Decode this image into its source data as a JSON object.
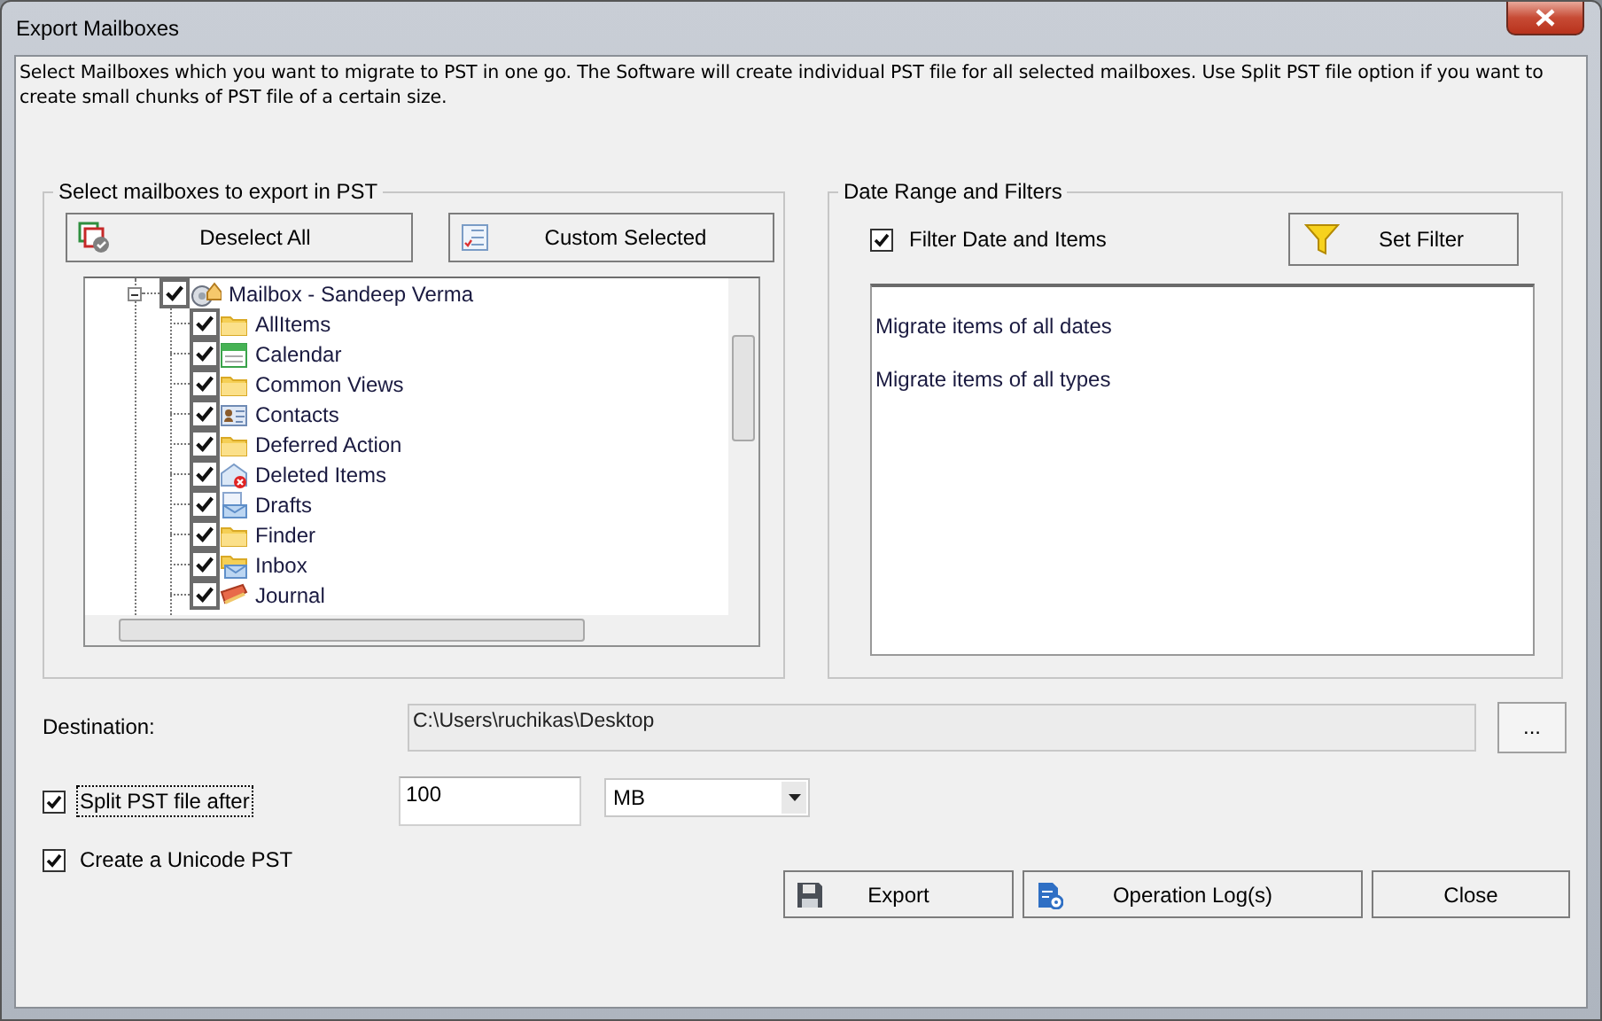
{
  "window": {
    "title": "Export Mailboxes"
  },
  "description": "Select Mailboxes which you want to migrate to PST in one go. The Software will create individual PST file for all selected mailboxes. Use Split PST file option if you want to create small chunks of PST file of a certain size.",
  "mailbox_group": {
    "title": "Select mailboxes to export in PST",
    "buttons": [
      {
        "label": "Deselect All"
      },
      {
        "label": "Custom Selected"
      }
    ],
    "tree": [
      {
        "label": "Mailbox - Sandeep  Verma",
        "kind": "mailbox",
        "checked": true,
        "expanded": true,
        "children": [
          {
            "label": "AllItems",
            "kind": "folder",
            "checked": true
          },
          {
            "label": "Calendar",
            "kind": "calendar",
            "checked": true
          },
          {
            "label": "Common Views",
            "kind": "folder",
            "checked": true
          },
          {
            "label": "Contacts",
            "kind": "contacts",
            "checked": true
          },
          {
            "label": "Deferred Action",
            "kind": "folder",
            "checked": true
          },
          {
            "label": "Deleted Items",
            "kind": "deleted",
            "checked": true
          },
          {
            "label": "Drafts",
            "kind": "drafts",
            "checked": true
          },
          {
            "label": "Finder",
            "kind": "folder",
            "checked": true
          },
          {
            "label": "Inbox",
            "kind": "inbox",
            "checked": true
          },
          {
            "label": "Journal",
            "kind": "journal",
            "checked": true
          }
        ]
      }
    ]
  },
  "filter_group": {
    "title": "Date Range and Filters",
    "filter_checkbox": {
      "label": "Filter Date and Items",
      "checked": true
    },
    "set_filter_button": "Set Filter",
    "summary": [
      "Migrate items of all dates",
      "Migrate items of all types"
    ]
  },
  "destination": {
    "label": "Destination:",
    "value": "C:\\Users\\ruchikas\\Desktop",
    "browse_button": "..."
  },
  "split": {
    "label": "Split PST file after",
    "checked": true,
    "focused": true,
    "size": "100",
    "unit": "MB"
  },
  "unicode": {
    "label": "Create a Unicode PST",
    "checked": true
  },
  "buttons": [
    {
      "label": "Export"
    },
    {
      "label": "Operation Log(s)"
    },
    {
      "label": "Close"
    }
  ]
}
